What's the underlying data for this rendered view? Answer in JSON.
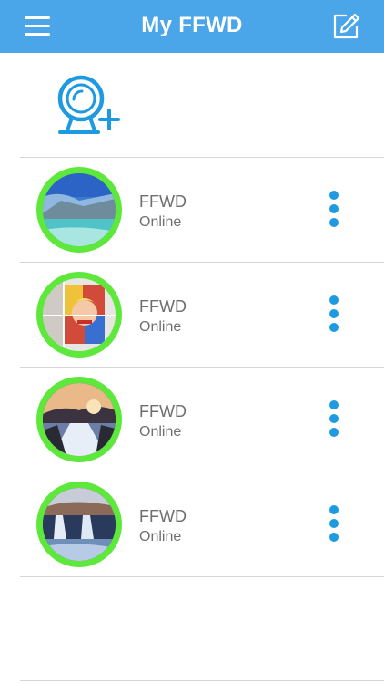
{
  "header": {
    "title": "My FFWD",
    "menu_icon": "hamburger-menu-icon",
    "edit_icon": "edit-pencil-icon",
    "background_color": "#4aa6e8"
  },
  "add_device": {
    "icon": "add-camera-icon",
    "color": "#1e9be0"
  },
  "devices": [
    {
      "name": "FFWD",
      "status": "Online",
      "image": "lake-landscape-thumbnail"
    },
    {
      "name": "FFWD",
      "status": "Online",
      "image": "pop-art-portrait-thumbnail"
    },
    {
      "name": "FFWD",
      "status": "Online",
      "image": "river-sunset-thumbnail"
    },
    {
      "name": "FFWD",
      "status": "Online",
      "image": "waterfall-night-thumbnail"
    }
  ],
  "colors": {
    "online_ring": "#5ee83b",
    "more_dots": "#1e9be0",
    "text": "#6f6f6f"
  }
}
